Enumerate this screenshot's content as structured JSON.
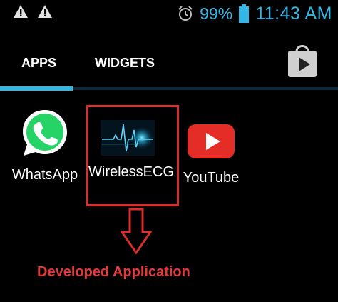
{
  "status_bar": {
    "icons": [
      "warning-icon",
      "warning-icon",
      "alarm-icon",
      "battery-icon"
    ],
    "battery_percent": "99%",
    "time": "11:43 AM",
    "accent_color": "#33b5e5"
  },
  "tabs": [
    {
      "label": "APPS",
      "selected": true
    },
    {
      "label": "WIDGETS",
      "selected": false
    }
  ],
  "toolbar": {
    "icon": "play-store-icon"
  },
  "apps": [
    {
      "label": "WhatsApp",
      "icon": "whatsapp-icon"
    },
    {
      "label": "WirelessECG",
      "icon": "ecg-icon"
    },
    {
      "label": "YouTube",
      "icon": "youtube-icon"
    }
  ],
  "annotation": {
    "text": "Developed Application",
    "color": "#d92e2e"
  }
}
